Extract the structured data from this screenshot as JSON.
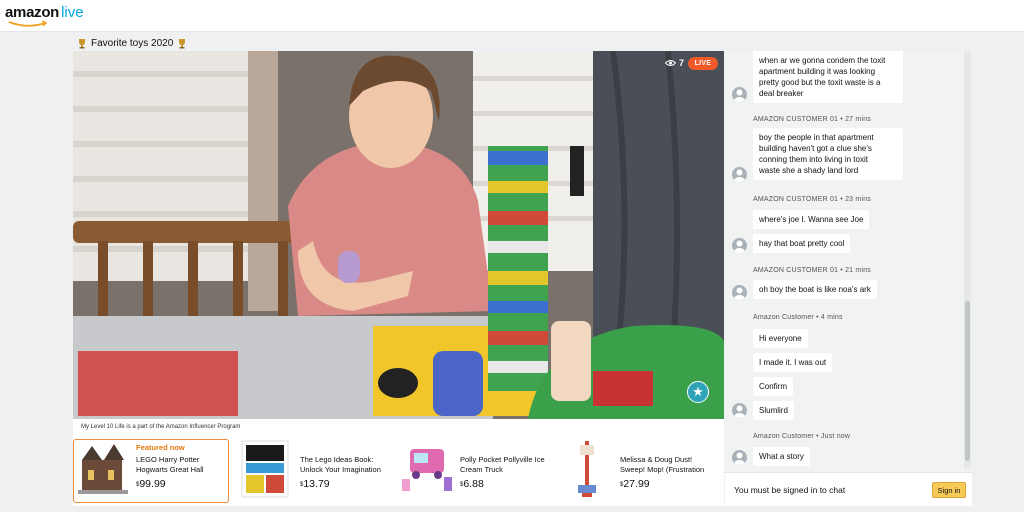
{
  "app": {
    "logo_main": "amazon",
    "logo_sub": "live"
  },
  "stream": {
    "title": "Favorite toys 2020",
    "viewer_count": "7",
    "live_label": "LIVE"
  },
  "products": {
    "program_note": "My Level 10 Life is a part of the Amazon Influencer Program",
    "items": [
      {
        "badge": "Featured now",
        "name_line1": "LEGO Harry Potter",
        "name_line2": "Hogwarts Great Hall",
        "currency": "$",
        "price": "99.99"
      },
      {
        "name_line1": "The Lego Ideas Book:",
        "name_line2": "Unlock Your Imagination",
        "currency": "$",
        "price": "13.79"
      },
      {
        "name_line1": "Polly Pocket Pollyville Ice",
        "name_line2": "Cream Truck",
        "currency": "$",
        "price": "6.88"
      },
      {
        "name_line1": "Melissa & Doug Dust!",
        "name_line2": "Sweep! Mop! (Frustration",
        "currency": "$",
        "price": "27.99"
      }
    ]
  },
  "chat": {
    "messages": [
      {
        "text_lines": [
          "when ar we gonna condem the toxit",
          "apartment building it was looking",
          "pretty good but the toxit waste is a",
          "deal breaker"
        ]
      },
      {
        "header": "AMAZON CUSTOMER 01 • 27 mins",
        "text_lines": [
          "boy the people in that apartment",
          "building haven't got a clue she's",
          "conning them into living in toxit",
          "waste she a shady land lord"
        ]
      },
      {
        "header": "AMAZON CUSTOMER 01 • 23 mins",
        "text_lines": [
          "where's joe I. Wanna see Joe"
        ]
      },
      {
        "text_lines": [
          "hay that boat pretty cool"
        ]
      },
      {
        "header": "AMAZON CUSTOMER 01 • 21 mins",
        "text_lines": [
          "oh boy the boat is like noa's ark"
        ]
      },
      {
        "header": "Amazon Customer • 4 mins",
        "text_lines": [
          "Hi everyone"
        ]
      },
      {
        "text_lines": [
          "I made it.  I was out"
        ]
      },
      {
        "text_lines": [
          "Confirm"
        ]
      },
      {
        "text_lines": [
          "Slumlird"
        ]
      },
      {
        "header": "Amazon Customer • Just now",
        "text_lines": [
          "What a story"
        ]
      }
    ],
    "signed_in_note": "You must be signed in to chat",
    "sign_in_label": "Sign in"
  },
  "colors": {
    "live_badge": "#f05a28",
    "featured_border": "#f08c3a",
    "featured_text": "#e47911",
    "logo_live": "#00a8e1",
    "sign_in_button": "#f7ca57"
  }
}
